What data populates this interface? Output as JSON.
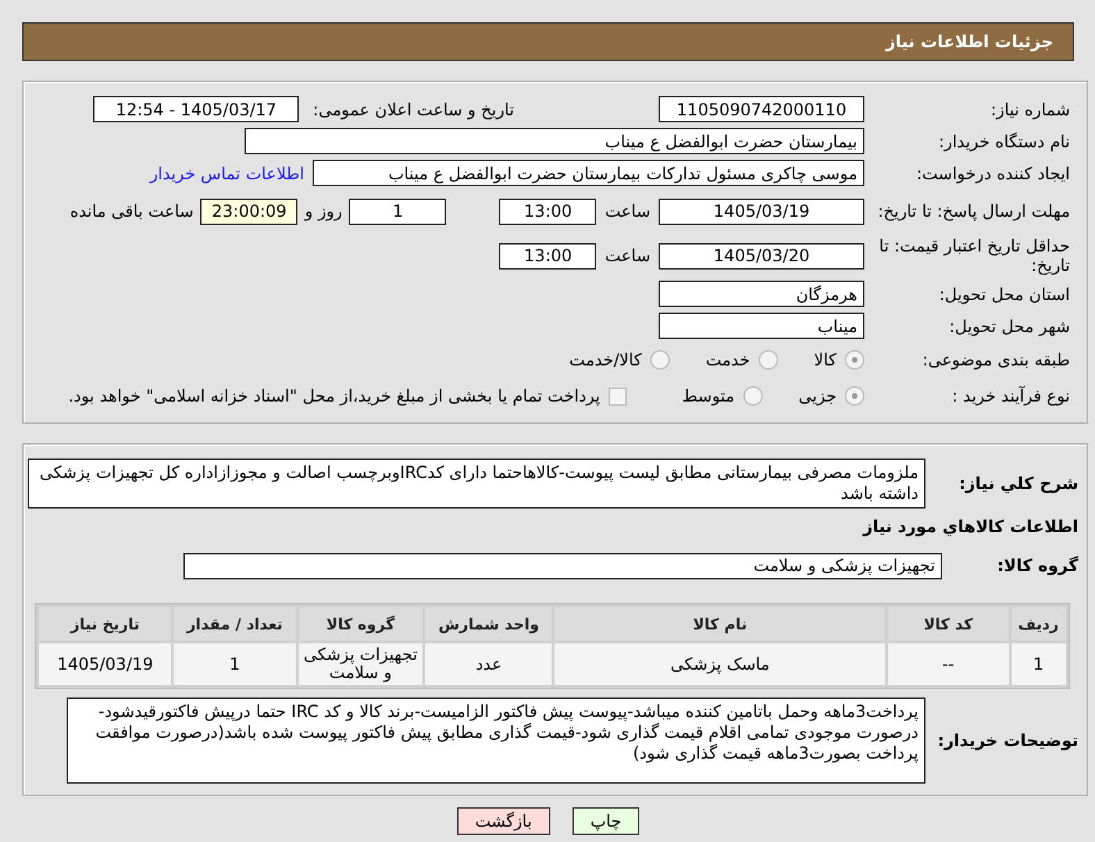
{
  "header": {
    "title": "جزئیات اطلاعات نیاز"
  },
  "details": {
    "need_number": {
      "label": "شماره نیاز:",
      "value": "1105090742000110"
    },
    "announce": {
      "label": "تاریخ و ساعت اعلان عمومی:",
      "value": "1405/03/17 - 12:54"
    },
    "buyer_org": {
      "label": "نام دستگاه خریدار:",
      "value": "بیمارستان حضرت ابوالفضل ع  میناب"
    },
    "creator": {
      "label": "ایجاد کننده درخواست:",
      "value": "موسی چاکری مسئول تدارکات بیمارستان حضرت ابوالفضل ع  میناب",
      "contact_link": "اطلاعات تماس خریدار"
    },
    "response_deadline": {
      "label": "مهلت ارسال پاسخ: تا تاریخ:",
      "date": "1405/03/19",
      "time_label": "ساعت",
      "time": "13:00",
      "days": "1",
      "days_label": "روز و",
      "remaining": "23:00:09",
      "remaining_label": "ساعت باقی مانده"
    },
    "price_validity": {
      "label": "حداقل تاریخ اعتبار قیمت: تا تاریخ:",
      "date": "1405/03/20",
      "time_label": "ساعت",
      "time": "13:00"
    },
    "province": {
      "label": "استان محل تحویل:",
      "value": "هرمزگان"
    },
    "city": {
      "label": "شهر محل تحویل:",
      "value": "میناب"
    },
    "category": {
      "label": "طبقه بندی موضوعی:",
      "options": [
        {
          "label": "کالا",
          "selected": true
        },
        {
          "label": "خدمت",
          "selected": false
        },
        {
          "label": "کالا/خدمت",
          "selected": false
        }
      ]
    },
    "process": {
      "label": "نوع فرآیند خرید :",
      "options": [
        {
          "label": "جزیی",
          "selected": true
        },
        {
          "label": "متوسط",
          "selected": false
        }
      ],
      "treasury": {
        "label": "پرداخت تمام یا بخشی از مبلغ خرید،از محل \"اسناد خزانه اسلامی\" خواهد بود.",
        "checked": false
      }
    }
  },
  "need": {
    "description": {
      "label": "شرح کلي نياز:",
      "value": "ملزومات مصرفی بیمارستانی مطابق لیست پیوست-کالاهاحتما دارای کدIRCوبرچسب اصالت و مجوزازاداره کل تجهیزات پزشکی داشته باشد"
    },
    "goods_heading": "اطلاعات کالاهاي مورد نياز",
    "goods_group": {
      "label": "گروه کالا:",
      "value": "تجهیزات پزشکی و سلامت"
    },
    "table": {
      "columns": [
        "ردیف",
        "کد کالا",
        "نام کالا",
        "واحد شمارش",
        "گروه کالا",
        "تعداد / مقدار",
        "تاریخ نیاز"
      ],
      "rows": [
        [
          "1",
          "--",
          "ماسک پزشکی",
          "عدد",
          "تجهیزات پزشکی و سلامت",
          "1",
          "1405/03/19"
        ]
      ]
    },
    "buyer_notes": {
      "label": "توضیحات خریدار:",
      "value": "پرداخت3ماهه وحمل باتامین کننده میباشد-پیوست پیش فاکتور الزامیست-برند کالا و کد IRC حتما درپیش فاکتورقیدشود-درصورت موجودی تمامی اقلام قیمت گذاری شود-قیمت گذاری مطابق پیش فاکتور پیوست شده باشد(درصورت موافقت پرداخت بصورت3ماهه قیمت گذاری شود)"
    }
  },
  "buttons": [
    {
      "label": "چاپ",
      "kind": "print"
    },
    {
      "label": "بازگشت",
      "kind": "back"
    }
  ]
}
